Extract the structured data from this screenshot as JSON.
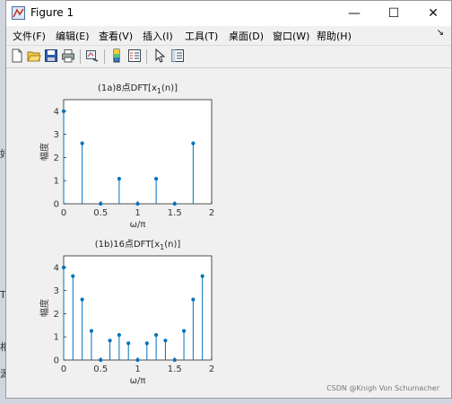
{
  "window": {
    "title": "Figure 1",
    "minimize_glyph": "—",
    "maximize_glyph": "☐",
    "close_glyph": "✕"
  },
  "menu": {
    "items": [
      "文件(F)",
      "编辑(E)",
      "查看(V)",
      "插入(I)",
      "工具(T)",
      "桌面(D)",
      "窗口(W)",
      "帮助(H)"
    ],
    "overflow_glyph": "↘"
  },
  "toolbar": {
    "icons": [
      "new-figure-icon",
      "open-file-icon",
      "save-icon",
      "print-icon",
      "link-plot-icon",
      "colorbar-icon",
      "legend-icon",
      "pointer-icon",
      "property-editor-icon"
    ]
  },
  "background_text": {
    "items": [
      "好",
      "T",
      "相",
      "源"
    ]
  },
  "watermark": "CSDN @Knigh Von Schumacher",
  "chart_data": [
    {
      "type": "stem",
      "title": "(1a)8点DFT[x1(n)]",
      "title_main": "(1a)8点DFT[x",
      "title_sub": "1",
      "title_tail": "(n)]",
      "xlabel": "ω/π",
      "ylabel": "幅度",
      "xlim": [
        0,
        2
      ],
      "ylim": [
        0,
        4.5
      ],
      "xticks": [
        0,
        0.5,
        1,
        1.5,
        2
      ],
      "yticks": [
        0,
        1,
        2,
        3,
        4
      ],
      "x": [
        0,
        0.25,
        0.5,
        0.75,
        1.0,
        1.25,
        1.5,
        1.75
      ],
      "y": [
        4.0,
        2.613,
        0,
        1.082,
        0,
        1.082,
        0,
        2.613
      ],
      "color": "#0072bd"
    },
    {
      "type": "stem",
      "title": "(1b)16点DFT[x1(n)]",
      "title_main": "(1b)16点DFT[x",
      "title_sub": "1",
      "title_tail": "(n)]",
      "xlabel": "ω/π",
      "ylabel": "幅度",
      "xlim": [
        0,
        2
      ],
      "ylim": [
        0,
        4.5
      ],
      "xticks": [
        0,
        0.5,
        1,
        1.5,
        2
      ],
      "yticks": [
        0,
        1,
        2,
        3,
        4
      ],
      "x": [
        0,
        0.125,
        0.25,
        0.375,
        0.5,
        0.625,
        0.75,
        0.875,
        1.0,
        1.125,
        1.25,
        1.375,
        1.5,
        1.625,
        1.75,
        1.875
      ],
      "y": [
        4.0,
        3.628,
        2.613,
        1.257,
        0,
        0.841,
        1.082,
        0.722,
        0,
        0.722,
        1.082,
        0.841,
        0,
        1.257,
        2.613,
        3.628
      ],
      "color": "#0072bd"
    }
  ]
}
